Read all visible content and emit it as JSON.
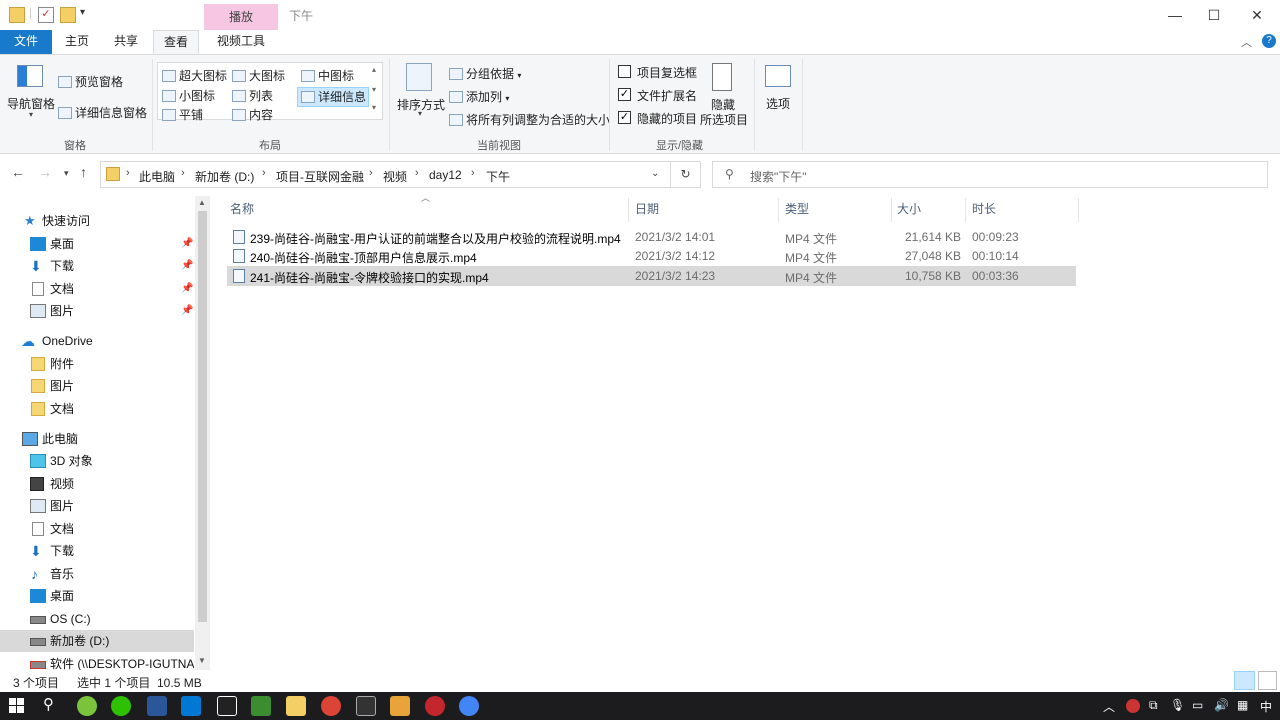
{
  "window": {
    "title": "下午",
    "context_tab": "播放",
    "controls": {
      "minimize": "—",
      "maximize": "☐",
      "close": "✕"
    }
  },
  "ribbon_tabs": {
    "file": "文件",
    "home": "主页",
    "share": "共享",
    "view": "查看",
    "video_tools": "视频工具"
  },
  "ribbon": {
    "panes": {
      "navigation_pane": "导航窗格",
      "preview_pane": "预览窗格",
      "details_pane": "详细信息窗格",
      "group_label": "窗格"
    },
    "layout": {
      "extra_large": "超大图标",
      "large": "大图标",
      "medium": "中图标",
      "small": "小图标",
      "list": "列表",
      "details": "详细信息",
      "tiles": "平铺",
      "content": "内容",
      "group_label": "布局"
    },
    "current_view": {
      "sort_by": "排序方式",
      "group_by": "分组依据",
      "add_columns": "添加列",
      "size_all_columns": "将所有列调整为合适的大小",
      "group_label": "当前视图"
    },
    "show_hide": {
      "item_checkboxes": "项目复选框",
      "item_checkboxes_checked": false,
      "file_extensions": "文件扩展名",
      "file_extensions_checked": true,
      "hidden_items": "隐藏的项目",
      "hidden_items_checked": true,
      "hide_selected_line1": "隐藏",
      "hide_selected_line2": "所选项目",
      "group_label": "显示/隐藏"
    },
    "options": "选项"
  },
  "address": {
    "crumbs": [
      "此电脑",
      "新加卷 (D:)",
      "项目-互联网金融",
      "视频",
      "day12",
      "下午"
    ],
    "search_placeholder": "搜索\"下午\""
  },
  "nav": {
    "quick_access": "快速访问",
    "qa_items": [
      "桌面",
      "下载",
      "文档",
      "图片"
    ],
    "onedrive": "OneDrive",
    "od_items": [
      "附件",
      "图片",
      "文档"
    ],
    "this_pc": "此电脑",
    "pc_items": [
      "3D 对象",
      "视频",
      "图片",
      "文档",
      "下载",
      "音乐",
      "桌面",
      "OS (C:)",
      "新加卷 (D:)",
      "软件 (\\\\DESKTOP-IGUTNAF"
    ]
  },
  "file_list": {
    "columns": {
      "name": "名称",
      "date": "日期",
      "type": "类型",
      "size": "大小",
      "duration": "时长"
    },
    "rows": [
      {
        "name": "239-尚硅谷-尚融宝-用户认证的前端整合以及用户校验的流程说明.mp4",
        "date": "2021/3/2 14:01",
        "type": "MP4 文件",
        "size": "21,614 KB",
        "duration": "00:09:23"
      },
      {
        "name": "240-尚硅谷-尚融宝-顶部用户信息展示.mp4",
        "date": "2021/3/2 14:12",
        "type": "MP4 文件",
        "size": "27,048 KB",
        "duration": "00:10:14"
      },
      {
        "name": "241-尚硅谷-尚融宝-令牌校验接口的实现.mp4",
        "date": "2021/3/2 14:23",
        "type": "MP4 文件",
        "size": "10,758 KB",
        "duration": "00:03:36"
      }
    ]
  },
  "status": {
    "count": "3 个项目",
    "selected": "选中 1 个项目  10.5 MB"
  },
  "taskbar": {
    "ime": "中",
    "colors": {
      "bg": "#1c1c1e",
      "accent": "#1979ca"
    }
  }
}
